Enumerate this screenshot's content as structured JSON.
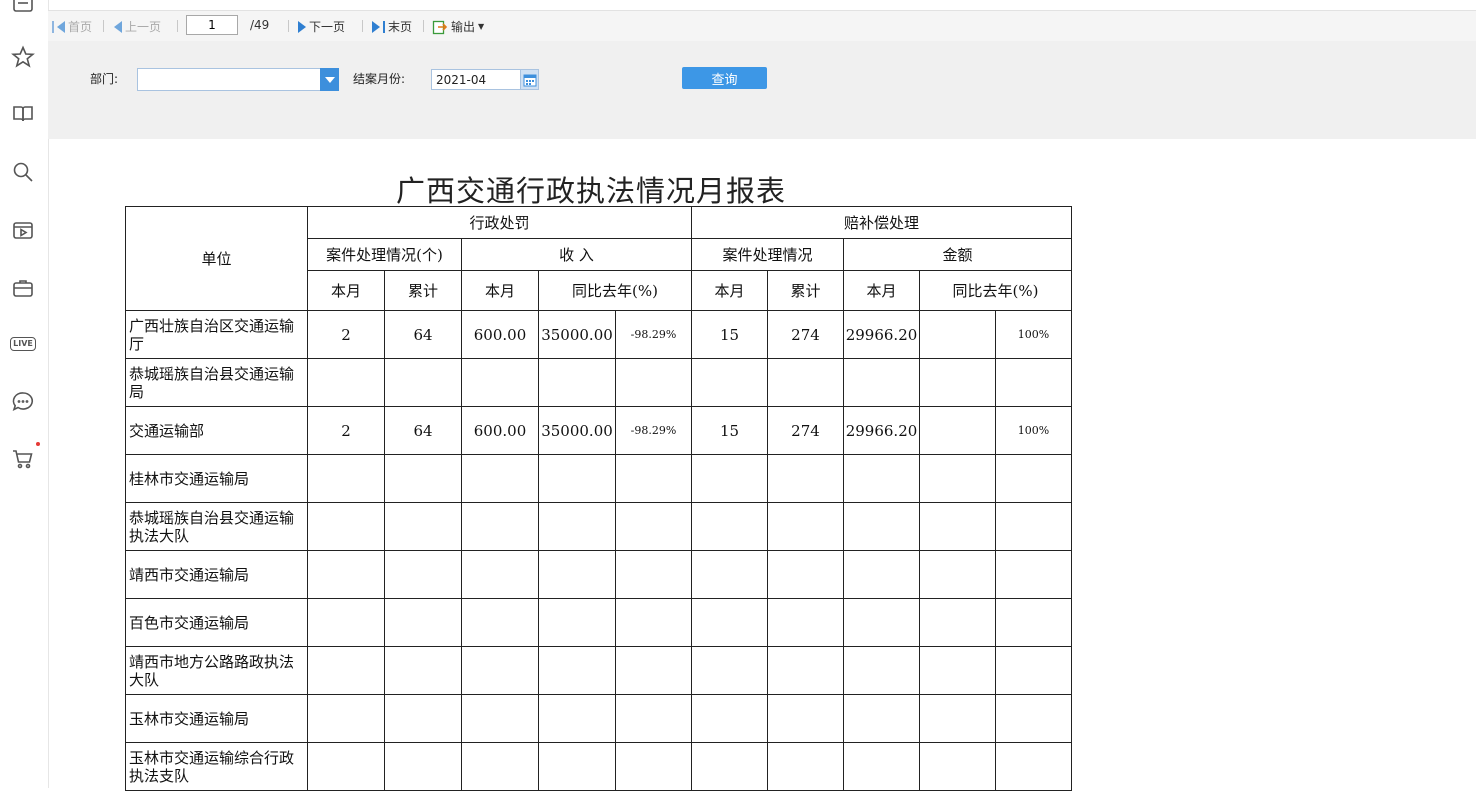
{
  "toolbar": {
    "first": "首页",
    "prev": "上一页",
    "page": "1",
    "total": "/49",
    "next": "下一页",
    "last": "末页",
    "export": "输出"
  },
  "filter": {
    "dept_label": "部门:",
    "dept_value": "",
    "month_label": "结案月份:",
    "month_value": "2021-04",
    "query": "查询"
  },
  "report": {
    "title": "广西交通行政执法情况月报表",
    "unit_header": "单位",
    "group_penalty": "行政处罚",
    "group_comp": "赔补偿处理",
    "sub_cases_penalty": "案件处理情况(个)",
    "sub_income": "收 入",
    "sub_cases_comp": "案件处理情况",
    "sub_amount": "金额",
    "col_month": "本月",
    "col_total": "累计",
    "col_yoy": "同比去年(%)",
    "rows": [
      {
        "unit": "广西壮族自治区交通运输厅",
        "c1": "2",
        "c2": "64",
        "c3": "600.00",
        "c4": "35000.00",
        "c5": "-98.29%",
        "c6": "15",
        "c7": "274",
        "c8": "29966.20",
        "c9": "",
        "c10": "100%"
      },
      {
        "unit": "恭城瑶族自治县交通运输局",
        "c1": "",
        "c2": "",
        "c3": "",
        "c4": "",
        "c5": "",
        "c6": "",
        "c7": "",
        "c8": "",
        "c9": "",
        "c10": ""
      },
      {
        "unit": "交通运输部",
        "c1": "2",
        "c2": "64",
        "c3": "600.00",
        "c4": "35000.00",
        "c5": "-98.29%",
        "c6": "15",
        "c7": "274",
        "c8": "29966.20",
        "c9": "",
        "c10": "100%"
      },
      {
        "unit": "桂林市交通运输局",
        "c1": "",
        "c2": "",
        "c3": "",
        "c4": "",
        "c5": "",
        "c6": "",
        "c7": "",
        "c8": "",
        "c9": "",
        "c10": ""
      },
      {
        "unit": "恭城瑶族自治县交通运输执法大队",
        "c1": "",
        "c2": "",
        "c3": "",
        "c4": "",
        "c5": "",
        "c6": "",
        "c7": "",
        "c8": "",
        "c9": "",
        "c10": ""
      },
      {
        "unit": "靖西市交通运输局",
        "c1": "",
        "c2": "",
        "c3": "",
        "c4": "",
        "c5": "",
        "c6": "",
        "c7": "",
        "c8": "",
        "c9": "",
        "c10": ""
      },
      {
        "unit": "百色市交通运输局",
        "c1": "",
        "c2": "",
        "c3": "",
        "c4": "",
        "c5": "",
        "c6": "",
        "c7": "",
        "c8": "",
        "c9": "",
        "c10": ""
      },
      {
        "unit": "靖西市地方公路路政执法大队",
        "c1": "",
        "c2": "",
        "c3": "",
        "c4": "",
        "c5": "",
        "c6": "",
        "c7": "",
        "c8": "",
        "c9": "",
        "c10": ""
      },
      {
        "unit": "玉林市交通运输局",
        "c1": "",
        "c2": "",
        "c3": "",
        "c4": "",
        "c5": "",
        "c6": "",
        "c7": "",
        "c8": "",
        "c9": "",
        "c10": ""
      },
      {
        "unit": "玉林市交通运输综合行政执法支队",
        "c1": "",
        "c2": "",
        "c3": "",
        "c4": "",
        "c5": "",
        "c6": "",
        "c7": "",
        "c8": "",
        "c9": "",
        "c10": ""
      }
    ]
  },
  "sidebar_icons": [
    "list-icon",
    "star-icon",
    "book-icon",
    "search-icon",
    "video-icon",
    "briefcase-icon",
    "live-icon",
    "chat-icon",
    "cart-icon"
  ],
  "live_label": "LIVE",
  "colors": {
    "accent": "#3d97e6",
    "toolbar_bg": "#f5f5f5",
    "filter_bg": "#f0f0f0"
  }
}
